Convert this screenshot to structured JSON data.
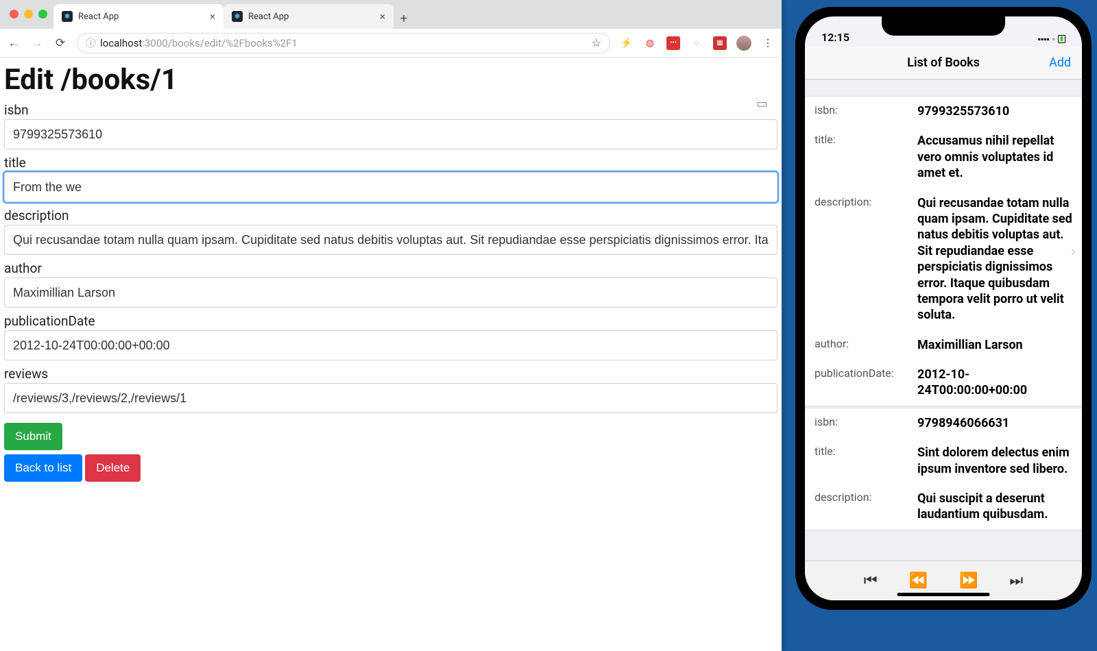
{
  "browser": {
    "tabs": [
      {
        "title": "React App",
        "active": true
      },
      {
        "title": "React App",
        "active": false
      }
    ],
    "url_host": "localhost",
    "url_path": ":3000/books/edit/%2Fbooks%2F1"
  },
  "page": {
    "heading": "Edit /books/1",
    "submit": "Submit",
    "back": "Back to list",
    "delete": "Delete",
    "fields": {
      "isbn": {
        "label": "isbn",
        "value": "9799325573610"
      },
      "title": {
        "label": "title",
        "value": "From the we"
      },
      "description": {
        "label": "description",
        "value": "Qui recusandae totam nulla quam ipsam. Cupiditate sed natus debitis voluptas aut. Sit repudiandae esse perspiciatis dignissimos error. Ita"
      },
      "author": {
        "label": "author",
        "value": "Maximillian Larson"
      },
      "publicationDate": {
        "label": "publicationDate",
        "value": "2012-10-24T00:00:00+00:00"
      },
      "reviews": {
        "label": "reviews",
        "value": "/reviews/3,/reviews/2,/reviews/1"
      }
    }
  },
  "phone": {
    "time": "12:15",
    "nav_title": "List of Books",
    "nav_add": "Add",
    "books": [
      {
        "isbn": "9799325573610",
        "title": "Accusamus nihil repellat vero omnis voluptates id amet et.",
        "description": "Qui recusandae totam nulla quam ipsam. Cupiditate sed natus debitis voluptas aut. Sit repudiandae esse perspiciatis dignissimos error. Itaque quibusdam tempora velit porro ut velit soluta.",
        "author": "Maximillian Larson",
        "publicationDate": "2012-10-24T00:00:00+00:00"
      },
      {
        "isbn": "9798946066631",
        "title": "Sint dolorem delectus enim ipsum inventore sed libero.",
        "description": "Qui suscipit a deserunt laudantium quibusdam."
      }
    ],
    "labels": {
      "isbn": "isbn:",
      "title": "title:",
      "description": "description:",
      "author": "author:",
      "publicationDate": "publicationDate:"
    }
  }
}
